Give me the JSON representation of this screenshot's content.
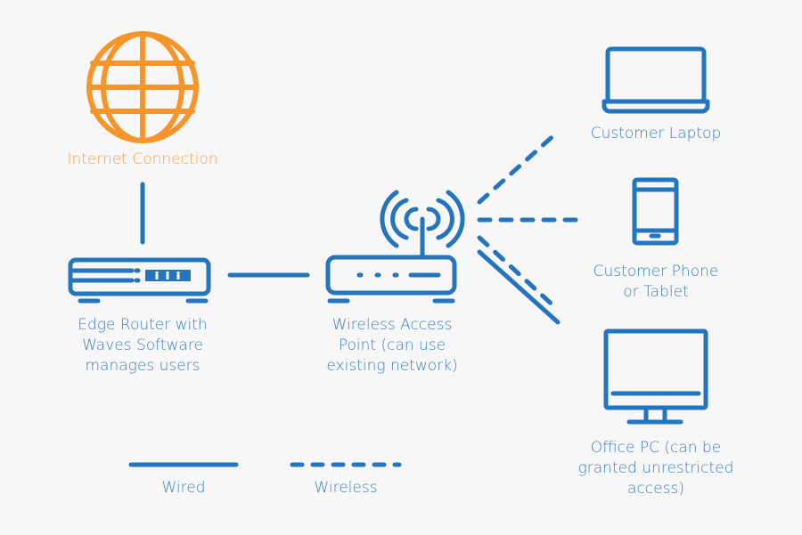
{
  "colors": {
    "primary": "#2574be",
    "label_blue": "#3d7fc0",
    "internet_orange": "#f7952b",
    "internet_label": "#f5a14a",
    "background": "#f7f7f7"
  },
  "nodes": {
    "internet": {
      "icon": "globe-icon",
      "label": "Internet Connection"
    },
    "edge_router": {
      "icon": "router-icon",
      "label_lines": [
        "Edge Router with",
        "Waves Software",
        "manages users"
      ]
    },
    "access_point": {
      "icon": "wireless-router-icon",
      "label_lines": [
        "Wireless Access",
        "Point (can use",
        "existing network)"
      ]
    },
    "laptop": {
      "icon": "laptop-icon",
      "label": "Customer Laptop"
    },
    "phone": {
      "icon": "phone-icon",
      "label_lines": [
        "Customer Phone",
        "or Tablet"
      ]
    },
    "office_pc": {
      "icon": "desktop-monitor-icon",
      "label_lines": [
        "Office PC (can be",
        "granted unrestricted",
        "access)"
      ]
    }
  },
  "connections": [
    {
      "from": "internet",
      "to": "edge_router",
      "type": "wired"
    },
    {
      "from": "edge_router",
      "to": "access_point",
      "type": "wired"
    },
    {
      "from": "access_point",
      "to": "laptop",
      "type": "wireless"
    },
    {
      "from": "access_point",
      "to": "phone",
      "type": "wireless"
    },
    {
      "from": "access_point",
      "to": "office_pc",
      "type": "wireless"
    },
    {
      "from": "access_point",
      "to": "office_pc",
      "type": "wired"
    }
  ],
  "legend": {
    "wired": "Wired",
    "wireless": "Wireless"
  }
}
